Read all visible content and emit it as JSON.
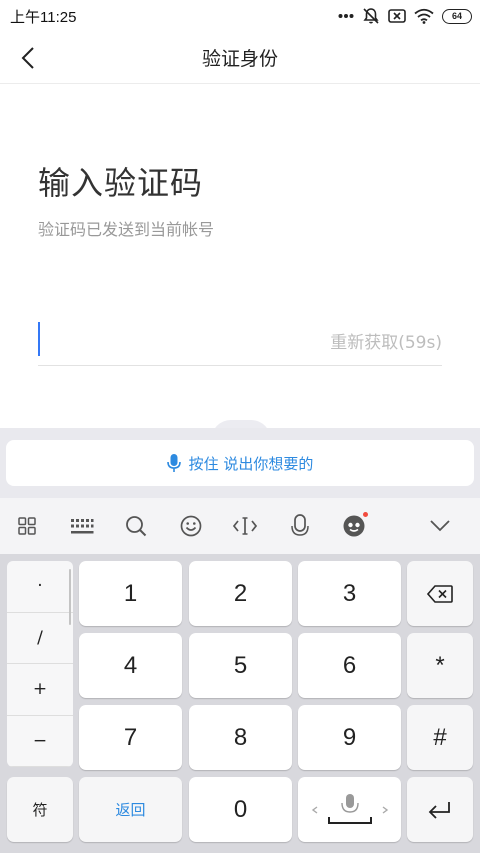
{
  "status_bar": {
    "time": "上午11:25",
    "battery": "64"
  },
  "header": {
    "title": "验证身份"
  },
  "content": {
    "heading": "输入验证码",
    "subtitle": "验证码已发送到当前帐号",
    "resend": "重新获取(59s)"
  },
  "keyboard": {
    "voice_prompt": "按住 说出你想要的",
    "toolbar_icons": [
      "apps-grid-icon",
      "keyboard-icon",
      "search-icon",
      "emoji-icon",
      "cursor-move-icon",
      "microphone-icon",
      "assistant-icon",
      "collapse-keyboard-icon"
    ],
    "symbols": [
      "·",
      "/",
      "+",
      "−"
    ],
    "digits": [
      "1",
      "2",
      "3",
      "4",
      "5",
      "6",
      "7",
      "8",
      "9"
    ],
    "side_keys": [
      "*",
      "#"
    ],
    "bottom": {
      "symbols": "符",
      "back": "返回",
      "zero": "0"
    }
  },
  "colors": {
    "accent": "#2d8ae0",
    "caret": "#3478f6",
    "keyboard_bg": "#d8d8dd"
  }
}
